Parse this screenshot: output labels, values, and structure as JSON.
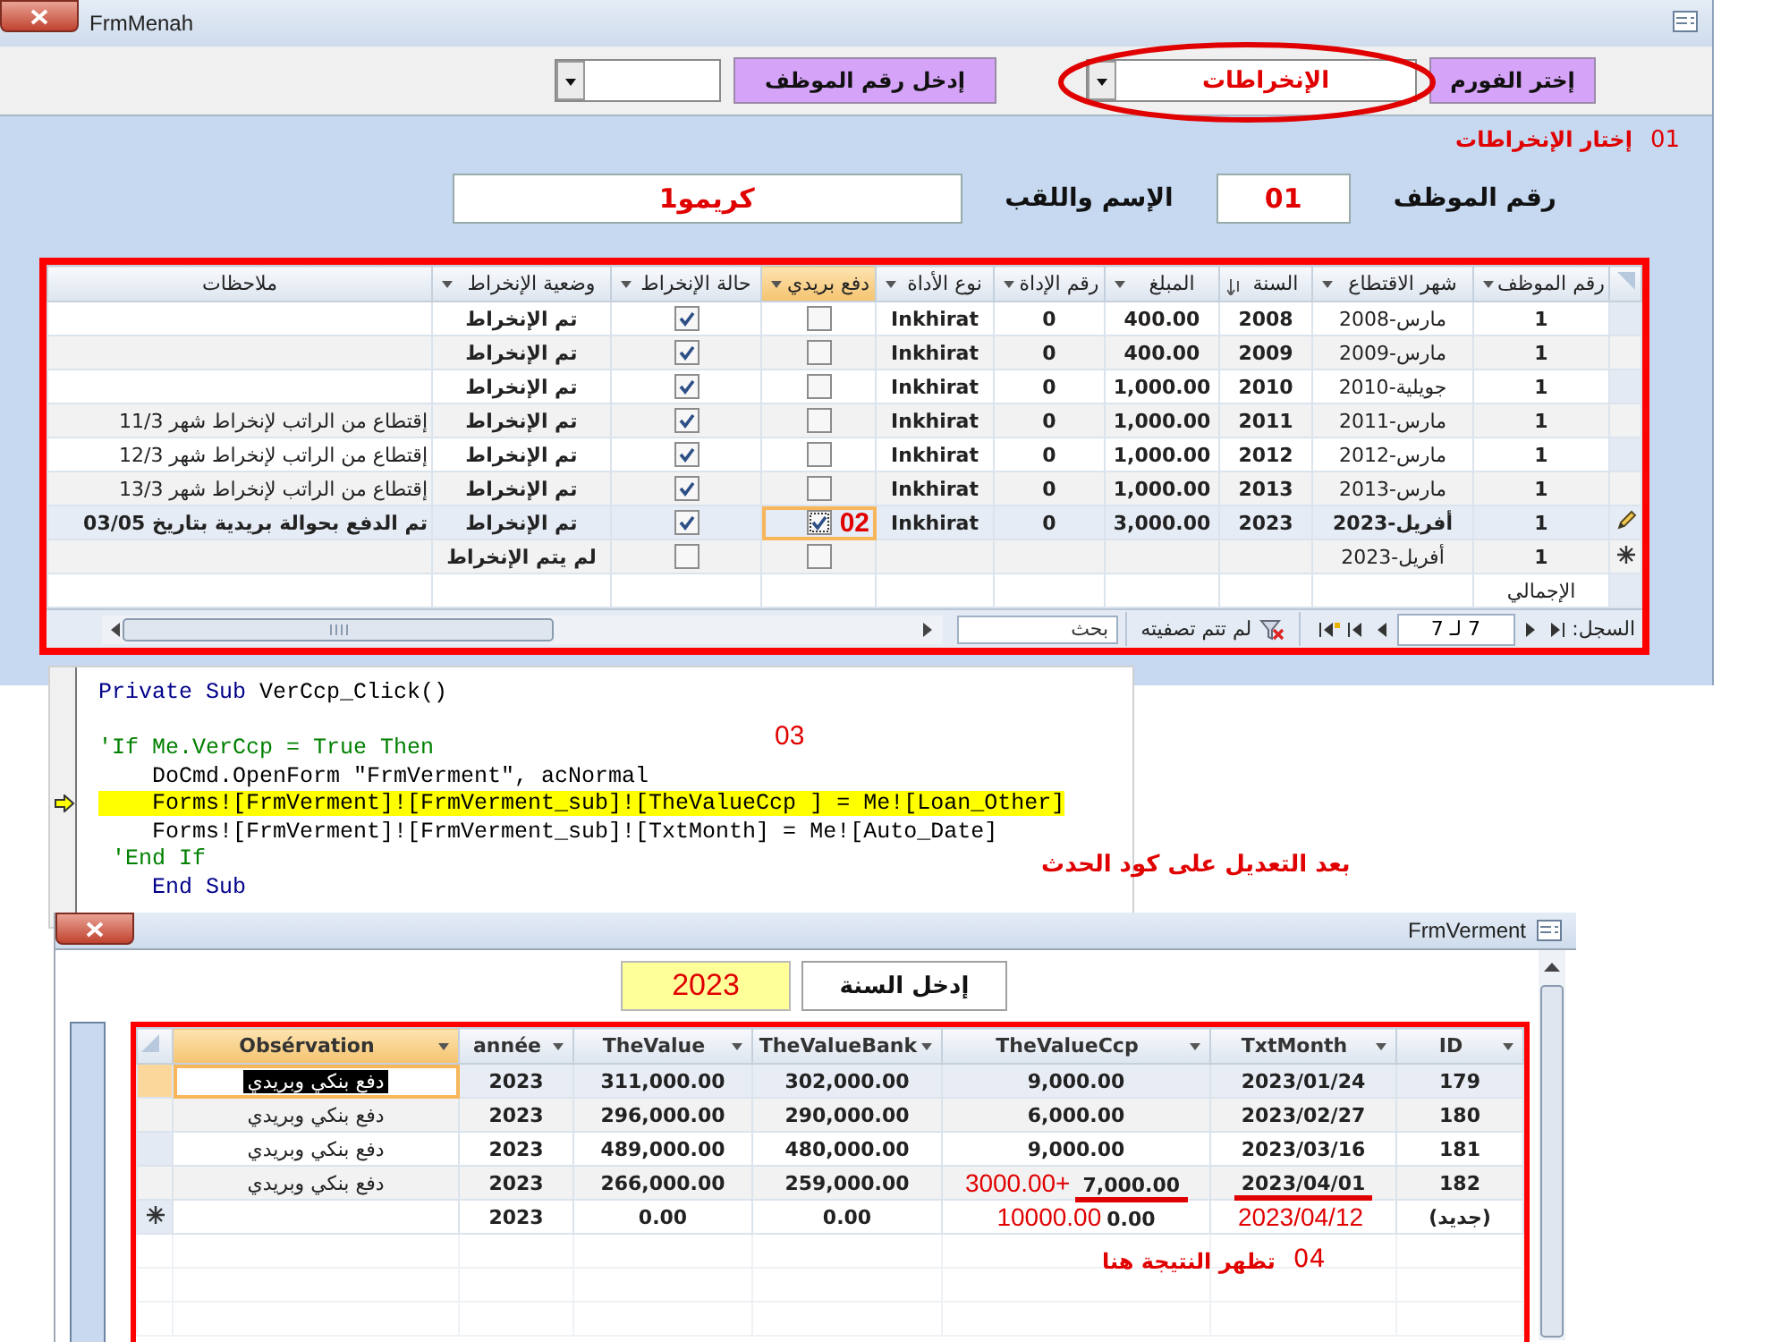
{
  "frm_menah": {
    "title": "FrmMenah",
    "form_picker": {
      "button": "إختر الفورم",
      "value": "الإنخراطات",
      "circled": true
    },
    "employee_picker": {
      "button": "إدخل رقم الموظف"
    },
    "note_01": {
      "number": "01",
      "text": "إختار الإنخراطات"
    },
    "fields": [
      {
        "label": "رقم الموظف",
        "value": "01"
      },
      {
        "label": "الإسم واللقب",
        "value": "كريمو1"
      }
    ],
    "table": {
      "columns": [
        {
          "label": "رقم الموظف",
          "kind": "text",
          "menu": true,
          "sorted": false,
          "active": false
        },
        {
          "label": "شهر الاقتطاع",
          "kind": "month",
          "menu": true,
          "sorted": false,
          "active": false
        },
        {
          "label": "السنة",
          "kind": "text",
          "menu": false,
          "sorted": true,
          "active": false
        },
        {
          "label": "المبلغ",
          "kind": "text",
          "menu": true,
          "sorted": false,
          "active": false
        },
        {
          "label": "رقم الإداة",
          "kind": "text",
          "menu": true,
          "sorted": false,
          "active": false
        },
        {
          "label": "نوع الأداة",
          "kind": "text",
          "menu": true,
          "sorted": false,
          "active": false
        },
        {
          "label": "دفع بريدي",
          "kind": "check",
          "menu": true,
          "sorted": false,
          "active": true
        },
        {
          "label": "حالة الإنخراط",
          "kind": "check",
          "menu": true,
          "sorted": false,
          "active": false
        },
        {
          "label": "وضعية الإنخراط",
          "kind": "text",
          "menu": true,
          "sorted": false,
          "active": false
        },
        {
          "label": "ملاحظات",
          "kind": "remark",
          "menu": false,
          "sorted": false,
          "active": false
        }
      ],
      "rows": [
        {
          "editing": false,
          "new_row": false,
          "current": false,
          "cells": [
            {
              "text": "1"
            },
            {
              "text": "مارس-2008"
            },
            {
              "text": "2008"
            },
            {
              "text": "400.00"
            },
            {
              "text": "0"
            },
            {
              "text": "Inkhirat"
            },
            {
              "checked": false
            },
            {
              "checked": true
            },
            {
              "text": "تم الإنخراط"
            },
            {}
          ]
        },
        {
          "editing": false,
          "new_row": false,
          "current": false,
          "cells": [
            {
              "text": "1"
            },
            {
              "text": "مارس-2009"
            },
            {
              "text": "2009"
            },
            {
              "text": "400.00"
            },
            {
              "text": "0"
            },
            {
              "text": "Inkhirat"
            },
            {
              "checked": false
            },
            {
              "checked": true
            },
            {
              "text": "تم الإنخراط"
            },
            {}
          ]
        },
        {
          "editing": false,
          "new_row": false,
          "current": false,
          "cells": [
            {
              "text": "1"
            },
            {
              "text": "جويلية-2010"
            },
            {
              "text": "2010"
            },
            {
              "text": "1,000.00"
            },
            {
              "text": "0"
            },
            {
              "text": "Inkhirat"
            },
            {
              "checked": false
            },
            {
              "checked": true
            },
            {
              "text": "تم الإنخراط"
            },
            {}
          ]
        },
        {
          "editing": false,
          "new_row": false,
          "current": false,
          "cells": [
            {
              "text": "1"
            },
            {
              "text": "مارس-2011"
            },
            {
              "text": "2011"
            },
            {
              "text": "1,000.00"
            },
            {
              "text": "0"
            },
            {
              "text": "Inkhirat"
            },
            {
              "checked": false
            },
            {
              "checked": true
            },
            {
              "text": "تم الإنخراط"
            },
            {
              "text": "إقتطاع من الراتب لإنخراط شهر 11/3"
            }
          ]
        },
        {
          "editing": false,
          "new_row": false,
          "current": false,
          "cells": [
            {
              "text": "1"
            },
            {
              "text": "مارس-2012"
            },
            {
              "text": "2012"
            },
            {
              "text": "1,000.00"
            },
            {
              "text": "0"
            },
            {
              "text": "Inkhirat"
            },
            {
              "checked": false
            },
            {
              "checked": true
            },
            {
              "text": "تم الإنخراط"
            },
            {
              "text": "إقتطاع من الراتب لإنخراط شهر 12/3"
            }
          ]
        },
        {
          "editing": false,
          "new_row": false,
          "current": false,
          "cells": [
            {
              "text": "1"
            },
            {
              "text": "مارس-2013"
            },
            {
              "text": "2013"
            },
            {
              "text": "1,000.00"
            },
            {
              "text": "0"
            },
            {
              "text": "Inkhirat"
            },
            {
              "checked": false
            },
            {
              "checked": true
            },
            {
              "text": "تم الإنخراط"
            },
            {
              "text": "إقتطاع من الراتب لإنخراط شهر 13/3"
            }
          ]
        },
        {
          "editing": true,
          "new_row": false,
          "current": true,
          "cells": [
            {
              "text": "1"
            },
            {
              "text": "أفريل-2023"
            },
            {
              "text": "2023"
            },
            {
              "text": "3,000.00"
            },
            {
              "text": "0"
            },
            {
              "text": "Inkhirat"
            },
            {
              "checked": true,
              "focused": true,
              "note": "02"
            },
            {
              "checked": true
            },
            {
              "text": "تم الإنخراط"
            },
            {
              "text": "تم الدفع بحوالة بريدية بتاريخ 03/05"
            }
          ]
        },
        {
          "editing": false,
          "new_row": true,
          "current": false,
          "cells": [
            {
              "text": "1"
            },
            {
              "text": "أفريل-2023"
            },
            {},
            {},
            {},
            {},
            {
              "checked": false
            },
            {
              "checked": false
            },
            {
              "text": "لم يتم الإنخراط"
            },
            {}
          ]
        }
      ],
      "total_label": "الإجمالي",
      "nav": {
        "label": "السجل:",
        "position": "7 لـ 7",
        "filter": "لم تتم تصفيته",
        "search_placeholder": "بحث"
      }
    }
  },
  "code": {
    "lines": [
      {
        "highlighted": false,
        "current": false,
        "keyword": "Private Sub",
        "text": " VerCcp_Click()"
      },
      {
        "highlighted": false,
        "current": false,
        "comment": "'If Me.VerCcp = True Then"
      },
      {
        "highlighted": false,
        "current": false,
        "text": "    DoCmd.OpenForm \"FrmVerment\", acNormal"
      },
      {
        "highlighted": true,
        "current": true,
        "text": "    Forms![FrmVerment]![FrmVerment_sub]![TheValueCcp ] = Me![Loan_Other]"
      },
      {
        "highlighted": false,
        "current": false,
        "text": "    Forms![FrmVerment]![FrmVerment_sub]![TxtMonth] = Me![Auto_Date]"
      },
      {
        "highlighted": false,
        "current": false,
        "comment": " 'End If"
      },
      {
        "highlighted": false,
        "current": false,
        "keyword": "    End Sub"
      }
    ],
    "note_03": "03",
    "caption": "بعد التعديل على كود الحدث"
  },
  "frm_verment": {
    "title": "FrmVerment",
    "year": "2023",
    "year_button": "إدخل السنة",
    "table": {
      "columns": [
        {
          "label": "ID",
          "active": false
        },
        {
          "label": "TxtMonth",
          "active": false
        },
        {
          "label": "TheValueCcp",
          "active": false
        },
        {
          "label": "TheValueBank",
          "active": false
        },
        {
          "label": "TheValue",
          "active": false
        },
        {
          "label": "année",
          "active": false
        },
        {
          "label": "Obsérvation",
          "active": true
        }
      ],
      "rows": [
        {
          "new_row": false,
          "current": true,
          "cells": [
            {
              "text": "179"
            },
            {
              "text": "2023/01/24"
            },
            {
              "text": "9,000.00"
            },
            {
              "text": "302,000.00"
            },
            {
              "text": "311,000.00"
            },
            {
              "text": "2023"
            },
            {
              "text": "دفع بنكي وبريدي",
              "selected": true
            }
          ]
        },
        {
          "new_row": false,
          "current": false,
          "cells": [
            {
              "text": "180"
            },
            {
              "text": "2023/02/27"
            },
            {
              "text": "6,000.00"
            },
            {
              "text": "290,000.00"
            },
            {
              "text": "296,000.00"
            },
            {
              "text": "2023"
            },
            {
              "text": "دفع بنكي وبريدي",
              "selected": false
            }
          ]
        },
        {
          "new_row": false,
          "current": false,
          "cells": [
            {
              "text": "181"
            },
            {
              "text": "2023/03/16"
            },
            {
              "text": "9,000.00"
            },
            {
              "text": "480,000.00"
            },
            {
              "text": "489,000.00"
            },
            {
              "text": "2023"
            },
            {
              "text": "دفع بنكي وبريدي",
              "selected": false
            }
          ]
        },
        {
          "new_row": false,
          "current": false,
          "cells": [
            {
              "text": "182"
            },
            {
              "text": "2023/04/01",
              "marked": true
            },
            {
              "note": "3000.00+",
              "text": "7,000.00",
              "marked": true
            },
            {
              "text": "259,000.00"
            },
            {
              "text": "266,000.00"
            },
            {
              "text": "2023"
            },
            {
              "text": "دفع بنكي وبريدي",
              "selected": false
            }
          ]
        },
        {
          "new_row": true,
          "current": false,
          "cells": [
            {
              "text": "(جديد)"
            },
            {
              "note": "2023/04/12"
            },
            {
              "note": "10000.00",
              "text": "0.00"
            },
            {
              "text": "0.00"
            },
            {
              "text": "0.00"
            },
            {
              "text": "2023"
            },
            {}
          ]
        }
      ],
      "note_04": {
        "number": "04",
        "text": "تظهر النتيجة هنا"
      }
    }
  }
}
